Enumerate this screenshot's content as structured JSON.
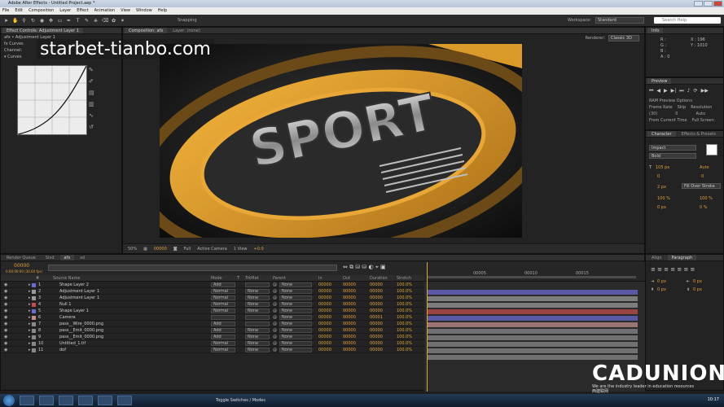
{
  "window": {
    "title": "Adobe After Effects - Untitled Project.aep *"
  },
  "menu": [
    "File",
    "Edit",
    "Composition",
    "Layer",
    "Effect",
    "Animation",
    "View",
    "Window",
    "Help"
  ],
  "toolbar": {
    "snapping": "Snapping",
    "workspace_label": "Workspace:",
    "workspace": "Standard",
    "search_placeholder": "Search Help"
  },
  "effects_panel": {
    "tab": "Effect Controls: Adjustment Layer 1",
    "rows": [
      "afx • Adjustment Layer 1",
      "fx  Curves",
      "   Channel:",
      "   ▾ Curves"
    ]
  },
  "viewer": {
    "tab1": "Composition: afx",
    "tab2": "Layer: (none)",
    "renderer_label": "Renderer:",
    "camera": "Classic 3D",
    "footer": {
      "zoom": "50%",
      "timecode": "00000",
      "quality": "Full",
      "view": "Active Camera",
      "views": "1 View",
      "exposure": "+0.0"
    },
    "artwork_text": "SPORT"
  },
  "info_panel": {
    "tab": "Info",
    "R": "R :",
    "G": "G :",
    "B": "B :",
    "A": "A : 0",
    "X": "X : 196",
    "Y": "Y : 1010"
  },
  "preview_panel": {
    "tab": "Preview",
    "ram_options": "RAM Preview Options",
    "frame_rate": "Frame Rate",
    "skip": "Skip",
    "resolution": "Resolution",
    "fps": "(30)",
    "skip_val": "0",
    "res_val": "Auto",
    "from_current": "From Current Time",
    "full_screen": "Full Screen"
  },
  "character_panel": {
    "tab1": "Character",
    "tab2": "Effects & Presets",
    "font": "Impact",
    "style": "Bold",
    "size": "105 px",
    "leading": "Auto",
    "kerning": "0",
    "tracking": "0",
    "stroke_w": "2 px",
    "stroke_type": "Fill Over Stroke",
    "vscale": "100 %",
    "hscale": "100 %",
    "baseline": "0 px",
    "tsume": "0 %"
  },
  "timeline": {
    "tabs": [
      "Render Queue",
      "Sixd",
      "afx",
      "sd"
    ],
    "timecode": "00000",
    "sub": "0:00:00:00 (30.00 fps)",
    "columns": [
      "#",
      "Source Name",
      "Mode",
      "T",
      "TrkMat",
      "Parent",
      "In",
      "Out",
      "Duration",
      "Stretch"
    ],
    "layers": [
      {
        "n": "1",
        "name": "Shape Layer 2",
        "mode": "Add",
        "trk": "",
        "parent": "None",
        "inp": "00000",
        "out": "00000",
        "dur": "00000",
        "str": "100.0%",
        "color": "#6a6ad0"
      },
      {
        "n": "2",
        "name": "Adjustment Layer 1",
        "mode": "Normal",
        "trk": "None",
        "parent": "None",
        "inp": "00000",
        "out": "00000",
        "dur": "00000",
        "str": "100.0%",
        "color": "#9a9a9a"
      },
      {
        "n": "3",
        "name": "Adjustment Layer 1",
        "mode": "Normal",
        "trk": "None",
        "parent": "None",
        "inp": "00000",
        "out": "00000",
        "dur": "00000",
        "str": "100.0%",
        "color": "#9a9a9a"
      },
      {
        "n": "4",
        "name": "Null 1",
        "mode": "Normal",
        "trk": "None",
        "parent": "None",
        "inp": "00000",
        "out": "00000",
        "dur": "00000",
        "str": "100.0%",
        "color": "#c24d4d"
      },
      {
        "n": "5",
        "name": "Shape Layer 1",
        "mode": "Normal",
        "trk": "None",
        "parent": "None",
        "inp": "00000",
        "out": "00000",
        "dur": "00000",
        "str": "100.0%",
        "color": "#6a6ad0"
      },
      {
        "n": "6",
        "name": "Camera",
        "mode": "",
        "trk": "",
        "parent": "None",
        "inp": "00000",
        "out": "00000",
        "dur": "00001",
        "str": "100.0%",
        "color": "#c28d8d"
      },
      {
        "n": "7",
        "name": "pass__Wire_0000.png",
        "mode": "Add",
        "trk": "",
        "parent": "None",
        "inp": "00000",
        "out": "00000",
        "dur": "00000",
        "str": "100.0%",
        "color": "#8a8a8a"
      },
      {
        "n": "8",
        "name": "pass__Emit_0000.png",
        "mode": "Add",
        "trk": "None",
        "parent": "None",
        "inp": "00000",
        "out": "00000",
        "dur": "00000",
        "str": "100.0%",
        "color": "#8a8a8a"
      },
      {
        "n": "9",
        "name": "pass__Emit_0000.png",
        "mode": "Add",
        "trk": "None",
        "parent": "None",
        "inp": "00000",
        "out": "00000",
        "dur": "00000",
        "str": "100.0%",
        "color": "#8a8a8a"
      },
      {
        "n": "10",
        "name": "Untitled_1.tif",
        "mode": "Normal",
        "trk": "None",
        "parent": "None",
        "inp": "00000",
        "out": "00000",
        "dur": "00000",
        "str": "100.0%",
        "color": "#8a8a8a"
      },
      {
        "n": "11",
        "name": "dof",
        "mode": "Normal",
        "trk": "None",
        "parent": "None",
        "inp": "00000",
        "out": "00000",
        "dur": "00000",
        "str": "100.0%",
        "color": "#8a8a8a"
      }
    ],
    "ruler": [
      "00005",
      "00010",
      "00015"
    ],
    "toggle": "Toggle Switches / Modes"
  },
  "paragraph_panel": {
    "tab1": "Align",
    "tab2": "Paragraph",
    "indent_l": "0 px",
    "indent_r": "0 px",
    "space_b": "0 px",
    "space_a": "0 px"
  },
  "watermark": "starbet-tianbo.com",
  "logo": {
    "name": "CADUNION",
    "tagline": "We are the industry leader in education resources",
    "cn": "西建联网"
  },
  "taskbar": {
    "clock": "10:17"
  }
}
